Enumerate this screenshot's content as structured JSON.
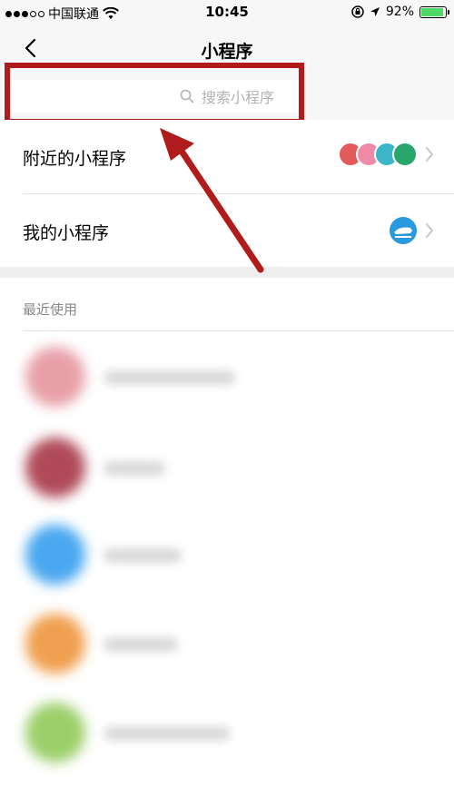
{
  "status_bar": {
    "carrier": "中国联通",
    "time": "10:45",
    "battery": "92%",
    "battery_level": 0.92
  },
  "nav": {
    "title": "小程序"
  },
  "search": {
    "placeholder": "搜索小程序"
  },
  "menu": {
    "nearby_label": "附近的小程序",
    "mine_label": "我的小程序"
  },
  "recent": {
    "title": "最近使用"
  },
  "colors": {
    "highlight": "#b01b1b",
    "arrow": "#b01b1b",
    "recent_avatars": [
      "#e8a0a8",
      "#b04a5a",
      "#4aa8f0",
      "#f0a050",
      "#9ccf6a"
    ]
  },
  "icons": {
    "nearby": [
      "red-map-pin-icon",
      "pink-shop-icon",
      "teal-card-icon",
      "green-bank-icon"
    ],
    "mine": [
      "blue-train-icon"
    ]
  }
}
